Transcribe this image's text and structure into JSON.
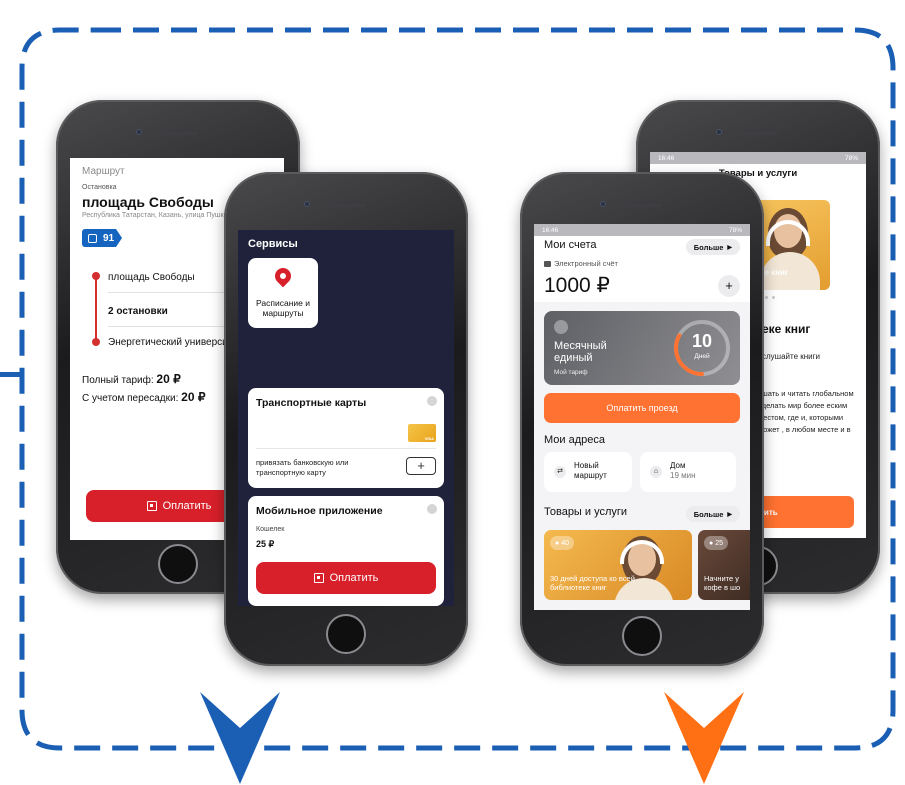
{
  "colors": {
    "frame": "#1a5fb4",
    "blue_arrow": "#1a5fb4",
    "orange_arrow": "#ff6f14",
    "red_accent": "#d8202a",
    "orange_accent": "#ff7231",
    "bus_blue": "#1565c0"
  },
  "route_screen": {
    "header": "Маршрут",
    "stop_caption": "Остановка",
    "stop_name": "площадь Свободы",
    "address": "Республика Татарстан, Казань, улица Пушк",
    "bus_number": "91",
    "bus_icon": "bus-icon",
    "stops": [
      {
        "name": "площадь Свободы",
        "bold": false
      },
      {
        "name": "2 остановки",
        "bold": true
      },
      {
        "name": "Энергетический университет",
        "bold": false
      }
    ],
    "full_fare_label": "Полный тариф:",
    "full_fare_value": "20 ₽",
    "transfer_fare_label": "С учетом пересадки:",
    "transfer_fare_value": "20 ₽",
    "pay_button": "Оплатить"
  },
  "services_screen": {
    "title": "Сервисы",
    "tile_label": "Расписание и маршруты",
    "tile_icon": "map-pin-icon",
    "transport_cards_title": "Транспортные карты",
    "card_chip_text": "VISA",
    "link_card_text": "привязать банковскую или транспортную карту",
    "add_button": "+",
    "mobile_app_title": "Мобильное приложение",
    "wallet_label": "Кошелек",
    "wallet_value": "25 ₽",
    "pay_button": "Оплатить"
  },
  "accounts_screen": {
    "status_time": "16:46",
    "status_icons": "78%",
    "title": "Мои счета",
    "more_label": "Больше",
    "ecard_label": "Электронный счёт",
    "balance": "1000 ₽",
    "add_button": "+",
    "tariff_name_1": "Месячный",
    "tariff_name_2": "единый",
    "tariff_caption": "Мой тариф",
    "days_number": "10",
    "days_label": "Дней",
    "days_progress": 0.33,
    "pay_trip_button": "Оплатить проезд",
    "addresses_title": "Мои адреса",
    "addresses": [
      {
        "line1": "Новый",
        "line2": "маршрут",
        "icon": "route-icon"
      },
      {
        "line1": "Дом",
        "line2": "19 мин",
        "icon": "home-icon"
      }
    ],
    "goods_title": "Товары и услуги",
    "goods_more": "Больше",
    "promos": [
      {
        "badge": "40",
        "text": "30 дней доступа ко всей библиотеке книг"
      },
      {
        "badge": "25",
        "text": "Начните у кофе в шо"
      }
    ]
  },
  "goods_screen": {
    "status_time": "16:46",
    "status_icons": "78%",
    "title": "Товары и услуги",
    "hero_text": "еке книг",
    "heading": "еке книг",
    "subheading": "слушайте книги",
    "body": "ушать и читать глобальном сделать мир более еским местом, где и, которыми может , в любом месте и в",
    "button": "тить"
  }
}
